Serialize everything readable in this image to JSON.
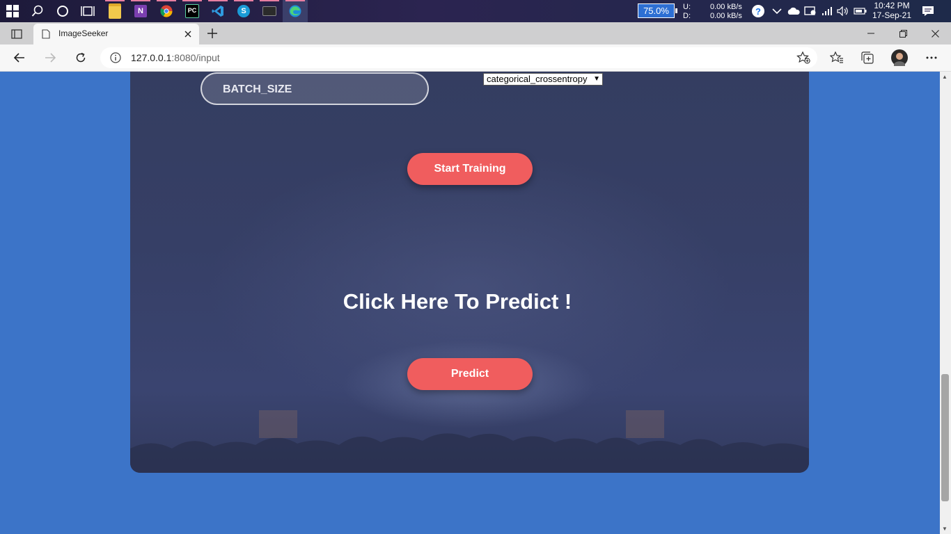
{
  "taskbar": {
    "battery_percent": "75.0%",
    "net_upload_label": "U:",
    "net_download_label": "D:",
    "net_upload": "0.00 kB/s",
    "net_download": "0.00 kB/s",
    "time": "10:42 PM",
    "date": "17-Sep-21",
    "icons": [
      "windows-start-icon",
      "search-icon",
      "cortana-icon",
      "task-view-icon",
      "file-explorer-icon",
      "onenote-icon",
      "chrome-icon",
      "pycharm-icon",
      "vscode-icon",
      "skype-icon",
      "terminal-icon",
      "edge-icon"
    ]
  },
  "browser": {
    "tab_title": "ImageSeeker",
    "url_host": "127.0.0.1",
    "url_rest": ":8080/input"
  },
  "page": {
    "batch_size_placeholder": "BATCH_SIZE",
    "loss_select_value": "categorical_crossentropy",
    "start_training_label": "Start Training",
    "predict_heading": "Click Here To Predict !",
    "predict_label": "Predict"
  },
  "colors": {
    "page_background": "#3c74c8",
    "card_background": "#363f66",
    "button": "#f05d5e",
    "battery_fill": "#2d6fd3"
  }
}
